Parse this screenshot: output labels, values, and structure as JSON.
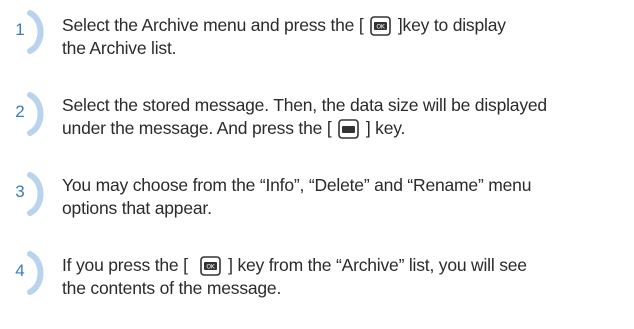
{
  "steps": [
    {
      "number": "1",
      "parts": {
        "a": "Select the Archive menu and press the [",
        "b": "]key to display",
        "c": "the Archive list."
      },
      "key_icon": "ok-key-icon"
    },
    {
      "number": "2",
      "parts": {
        "a": "Select the stored message. Then, the data size will be displayed",
        "b": "under the message. And press the [",
        "c": "] key."
      },
      "key_icon": "menu-key-icon"
    },
    {
      "number": "3",
      "parts": {
        "a": "You may choose from the “Info”, “Delete” and “Rename” menu",
        "b": "options that appear."
      }
    },
    {
      "number": "4",
      "parts": {
        "a": "If you press the [",
        "b": "] key from the “Archive” list, you will see",
        "c": "the contents of the message."
      },
      "key_icon": "ok-key-icon"
    }
  ],
  "colors": {
    "accent": "#3a7cc2",
    "text": "#2b2b2b"
  }
}
